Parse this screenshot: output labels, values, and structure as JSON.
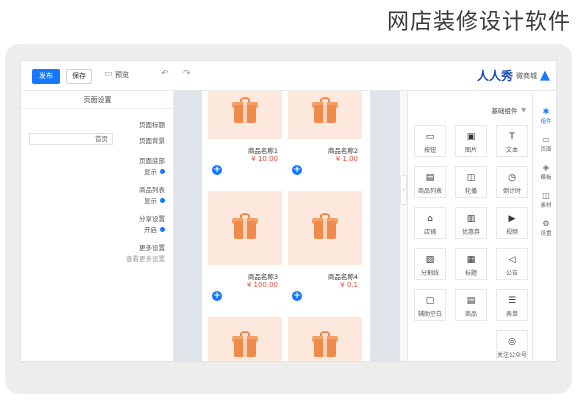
{
  "watermark": "网店装修设计软件",
  "toolbar": {
    "publish_label": "发布",
    "save_label": "保存",
    "preview_label": "预览",
    "preview_icon": "monitor-icon",
    "undo_icon": "undo-icon",
    "redo_icon": "redo-icon"
  },
  "brand": {
    "name": "人人秀",
    "tagline": "微商城",
    "logo_icon": "bird-logo-icon"
  },
  "left_panel": {
    "title": "页面设置",
    "rows": [
      {
        "label": "页面标题"
      },
      {
        "label": "页面背景"
      },
      {
        "label": "页面底部",
        "option": "显示"
      },
      {
        "label": "商品列表",
        "option": "显示"
      },
      {
        "label": "分享设置",
        "option": "开启"
      },
      {
        "label": "更多设置",
        "link": "查看更多设置"
      }
    ],
    "field_value": "首页"
  },
  "products": [
    {
      "name": "商品名称1",
      "price": "¥ 10.00"
    },
    {
      "name": "商品名称2",
      "price": "¥ 1.00"
    },
    {
      "name": "商品名称3",
      "price": "¥ 100.00"
    },
    {
      "name": "商品名称4",
      "price": "¥ 0.1"
    },
    {
      "name": "",
      "price": ""
    },
    {
      "name": "",
      "price": ""
    }
  ],
  "right_panel": {
    "heading": "基础组件",
    "components": [
      {
        "label": "文本",
        "icon": "T"
      },
      {
        "label": "图片",
        "icon": "▣"
      },
      {
        "label": "按钮",
        "icon": "▭"
      },
      {
        "label": "倒计时",
        "icon": "◷"
      },
      {
        "label": "轮播",
        "icon": "◫"
      },
      {
        "label": "商品列表",
        "icon": "▤"
      },
      {
        "label": "视频",
        "icon": "▶"
      },
      {
        "label": "优惠券",
        "icon": "▥"
      },
      {
        "label": "店铺",
        "icon": "⌂"
      },
      {
        "label": "公告",
        "icon": "◁"
      },
      {
        "label": "标题",
        "icon": "▦"
      },
      {
        "label": "分割线",
        "icon": "▨"
      },
      {
        "label": "表单",
        "icon": "☰"
      },
      {
        "label": "商品",
        "icon": "▤"
      },
      {
        "label": "辅助空白",
        "icon": "▢"
      },
      {
        "label": "关注公众号",
        "icon": "◎"
      }
    ]
  },
  "side_tabs": [
    {
      "label": "组件",
      "icon": "✱",
      "active": true
    },
    {
      "label": "页面",
      "icon": "▭"
    },
    {
      "label": "模板",
      "icon": "◈"
    },
    {
      "label": "素材",
      "icon": "◫"
    },
    {
      "label": "设置",
      "icon": "⚙"
    }
  ],
  "colors": {
    "accent": "#1677ff",
    "price": "#e74c3c",
    "gift_bg": "#fde8dd",
    "gift": "#f08a4b"
  }
}
